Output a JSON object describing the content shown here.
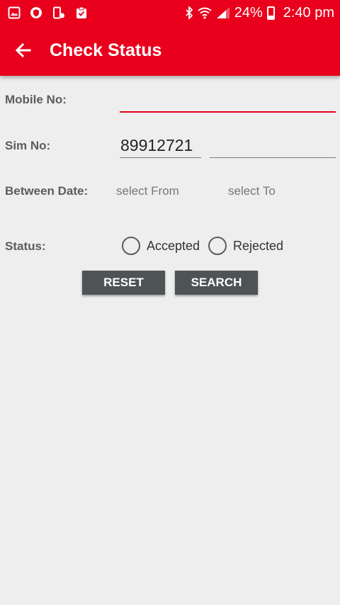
{
  "status_bar": {
    "battery": "24%",
    "time": "2:40 pm"
  },
  "app_bar": {
    "title": "Check Status"
  },
  "form": {
    "mobile_label": "Mobile No:",
    "mobile_value": "",
    "sim_label": "Sim No:",
    "sim_value": "89912721",
    "date_label": "Between Date:",
    "date_from": "select From",
    "date_to": "select To",
    "status_label": "Status:",
    "status_options": [
      "Accepted",
      "Rejected"
    ]
  },
  "buttons": {
    "reset": "RESET",
    "search": "SEARCH"
  },
  "colors": {
    "accent": "#e8001c",
    "button": "#4e5356",
    "background": "#eeeeee"
  }
}
